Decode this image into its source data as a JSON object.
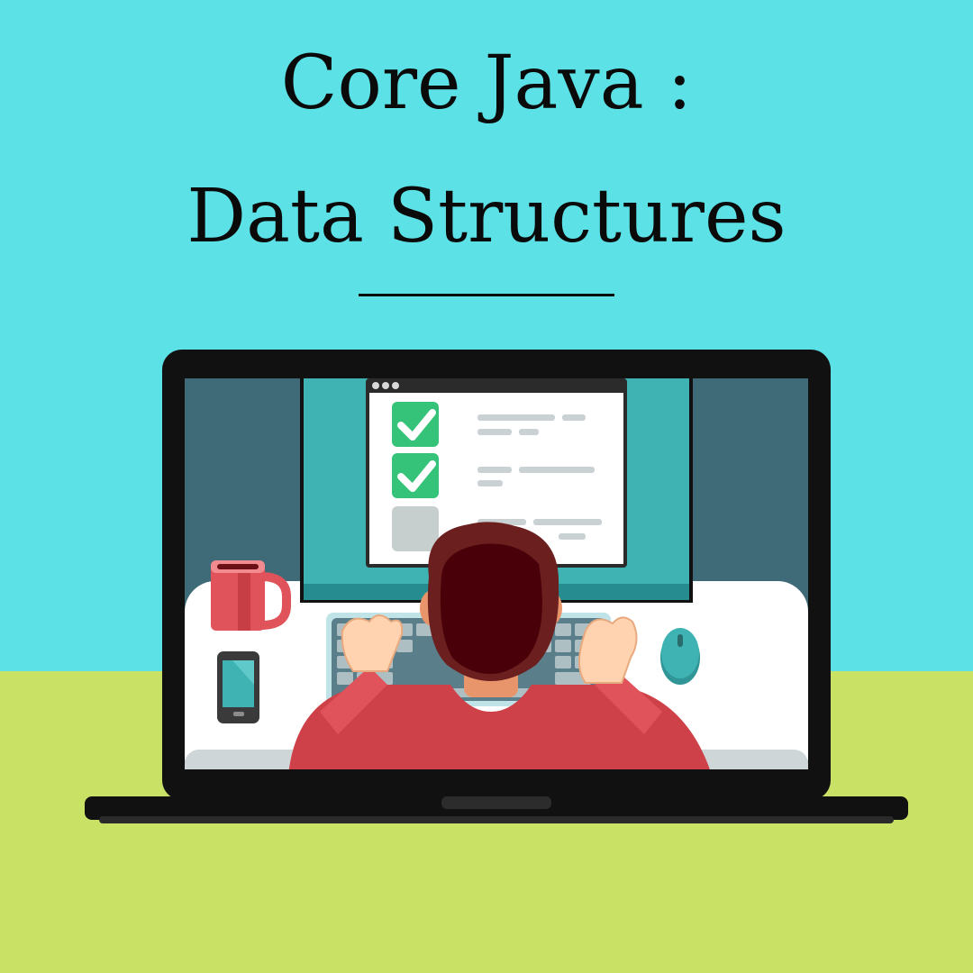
{
  "title": {
    "line1": "Core Java :",
    "line2": "Data Structures"
  },
  "colors": {
    "sky": "#5ce1e6",
    "ground": "#c9e265",
    "laptop_body": "#111111",
    "screen_wall": "#3f6b79",
    "monitor_teal": "#3fb3b3",
    "desk": "#ffffff",
    "shirt": "#cf4149",
    "hair": "#4a0008",
    "check_green": "#35c37a",
    "mug": "#e0535a"
  },
  "icons": {
    "check_1": "checkbox-checked-icon",
    "check_2": "checkbox-checked-icon",
    "check_3": "checkbox-empty-icon",
    "mug": "coffee-mug-icon",
    "phone": "smartphone-icon",
    "mouse": "computer-mouse-icon",
    "keyboard": "keyboard-icon"
  }
}
